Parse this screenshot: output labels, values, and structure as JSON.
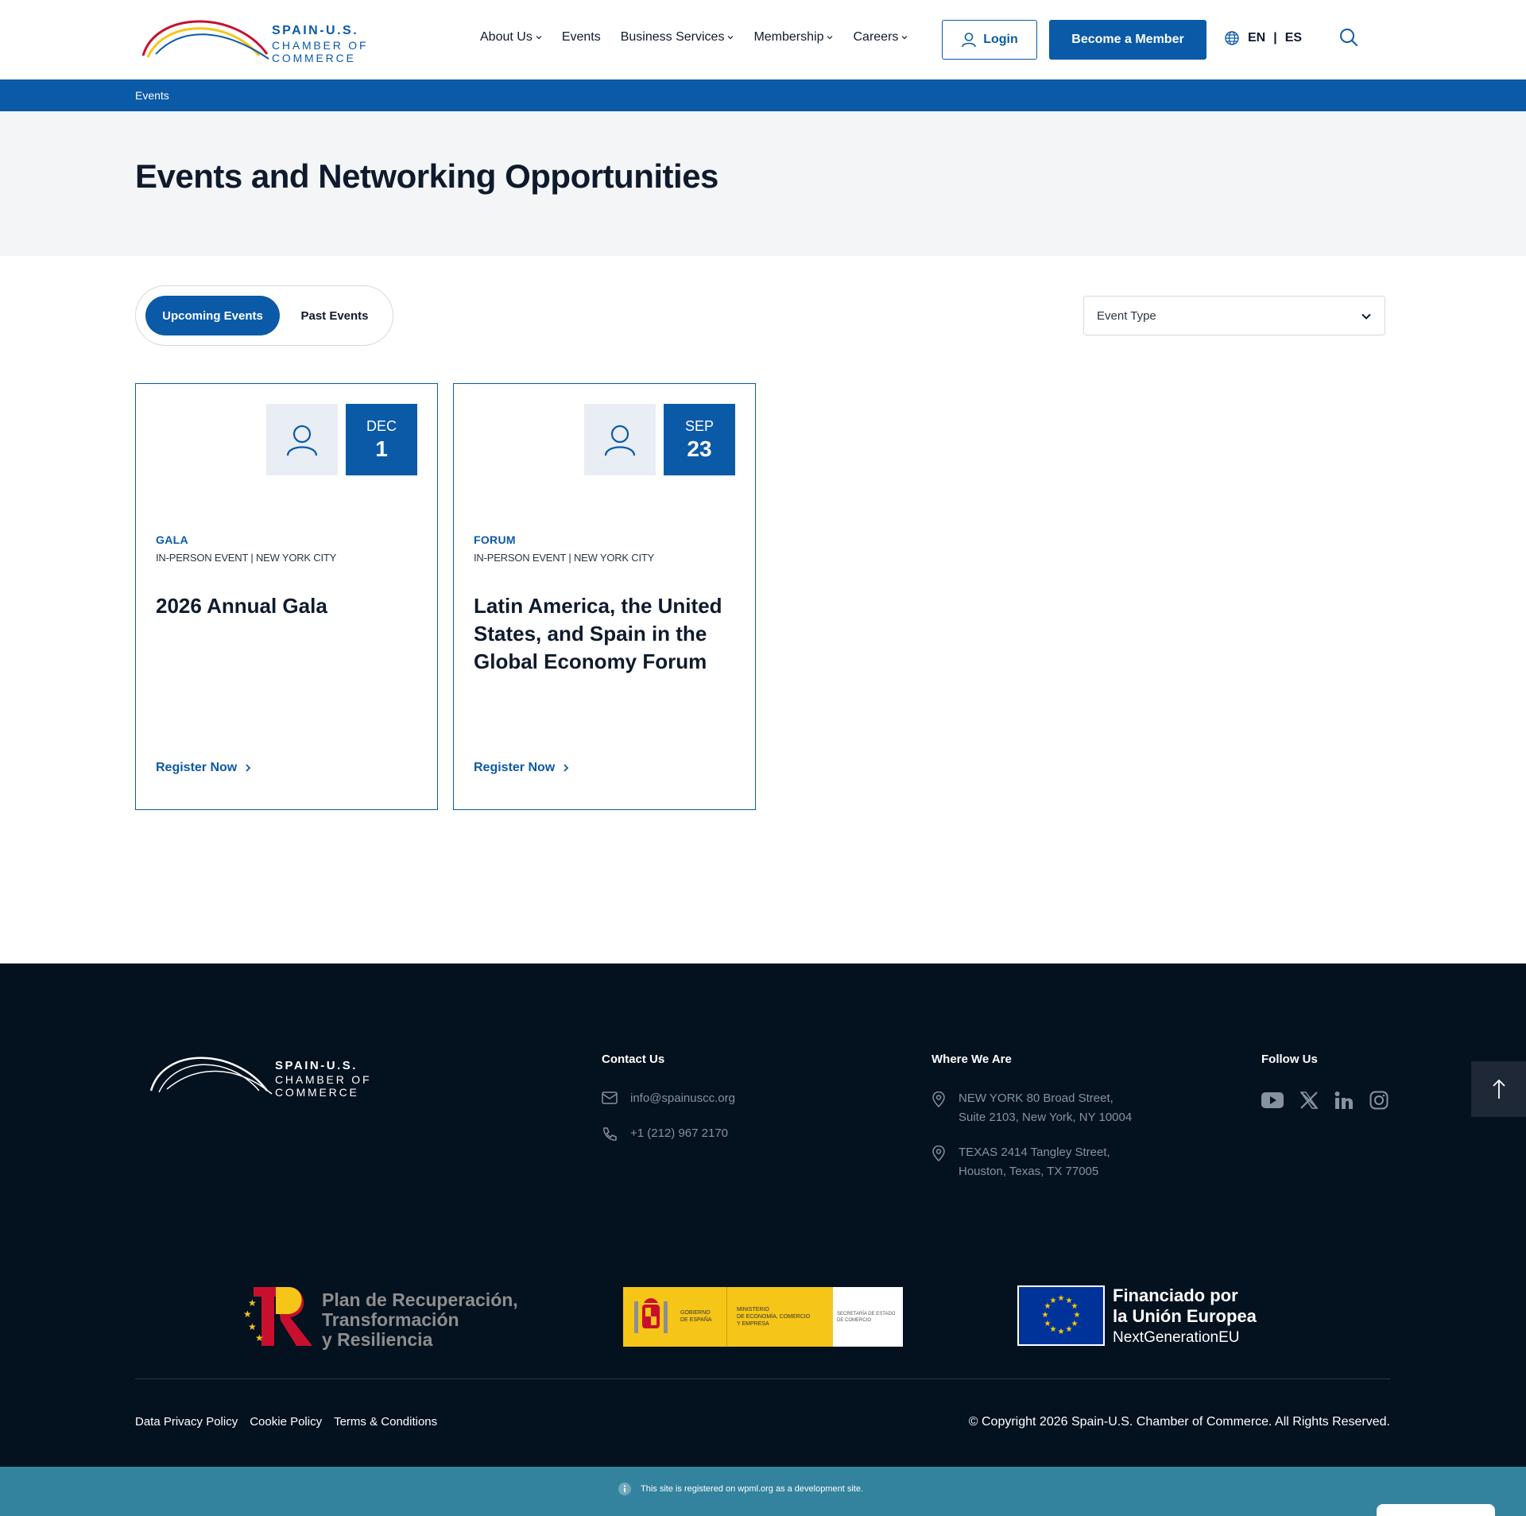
{
  "header": {
    "logo_line1": "SPAIN-U.S.",
    "logo_line2": "CHAMBER OF COMMERCE",
    "nav": [
      {
        "label": "About Us"
      },
      {
        "label": "Events"
      },
      {
        "label": "Business Services"
      },
      {
        "label": "Membership"
      },
      {
        "label": "Careers"
      }
    ],
    "login_label": "Login",
    "member_label": "Become a Member",
    "lang_en": "EN",
    "lang_sep": "|",
    "lang_es": "ES"
  },
  "breadcrumb": "Events",
  "page_title": "Events and Networking Opportunities",
  "filters": {
    "tab_upcoming": "Upcoming Events",
    "tab_past": "Past Events",
    "event_type_placeholder": "Event Type"
  },
  "events": [
    {
      "month": "DEC",
      "day": "1",
      "category": "GALA",
      "meta": "IN-PERSON EVENT | NEW YORK CITY",
      "title": "2026 Annual Gala",
      "link": "Register Now"
    },
    {
      "month": "SEP",
      "day": "23",
      "category": "FORUM",
      "meta": "IN-PERSON EVENT | NEW YORK CITY",
      "title": "Latin America, the United States, and Spain in the Global Economy Forum",
      "link": "Register Now"
    }
  ],
  "footer": {
    "logo_line1": "SPAIN-U.S.",
    "logo_line2": "CHAMBER OF COMMERCE",
    "contact_title": "Contact Us",
    "email": "info@spainuscc.org",
    "phone": "+1 (212) 967 2170",
    "where_title": "Where We Are",
    "ny_line1": "NEW YORK 80 Broad Street,",
    "ny_line2": "Suite 2103, New York, NY 10004",
    "tx_line1": "TEXAS 2414 Tangley Street,",
    "tx_line2": "Houston, Texas, TX 77005",
    "follow_title": "Follow Us",
    "social_icons": [
      "youtube-icon",
      "x-icon",
      "linkedin-icon",
      "instagram-icon"
    ],
    "fund_pr_line1": "Plan de Recuperación,",
    "fund_pr_line2": "Transformación",
    "fund_pr_line3": "y Resiliencia",
    "gov_1a": "GOBIERNO",
    "gov_1b": "DE ESPAÑA",
    "gov_2a": "MINISTERIO",
    "gov_2b": "DE ECONOMÍA, COMERCIO",
    "gov_2c": "Y EMPRESA",
    "gov_3a": "SECRETARÍA DE ESTADO",
    "gov_3b": "DE COMERCIO",
    "eu_line1": "Financiado por",
    "eu_line2": "la Unión Europea",
    "eu_line3": "NextGenerationEU",
    "legal": [
      "Data Privacy Policy",
      "Cookie Policy",
      "Terms & Conditions"
    ],
    "copyright": "© Copyright 2026 Spain-U.S. Chamber of Commerce. All Rights Reserved."
  },
  "wpml_notice": "This site is registered on wpml.org as a development site.",
  "colors": {
    "brand_blue": "#0b5aa8",
    "footer_bg": "#04111f",
    "wpml_bar": "#33839e",
    "hero_bg": "#f3f5f7"
  }
}
